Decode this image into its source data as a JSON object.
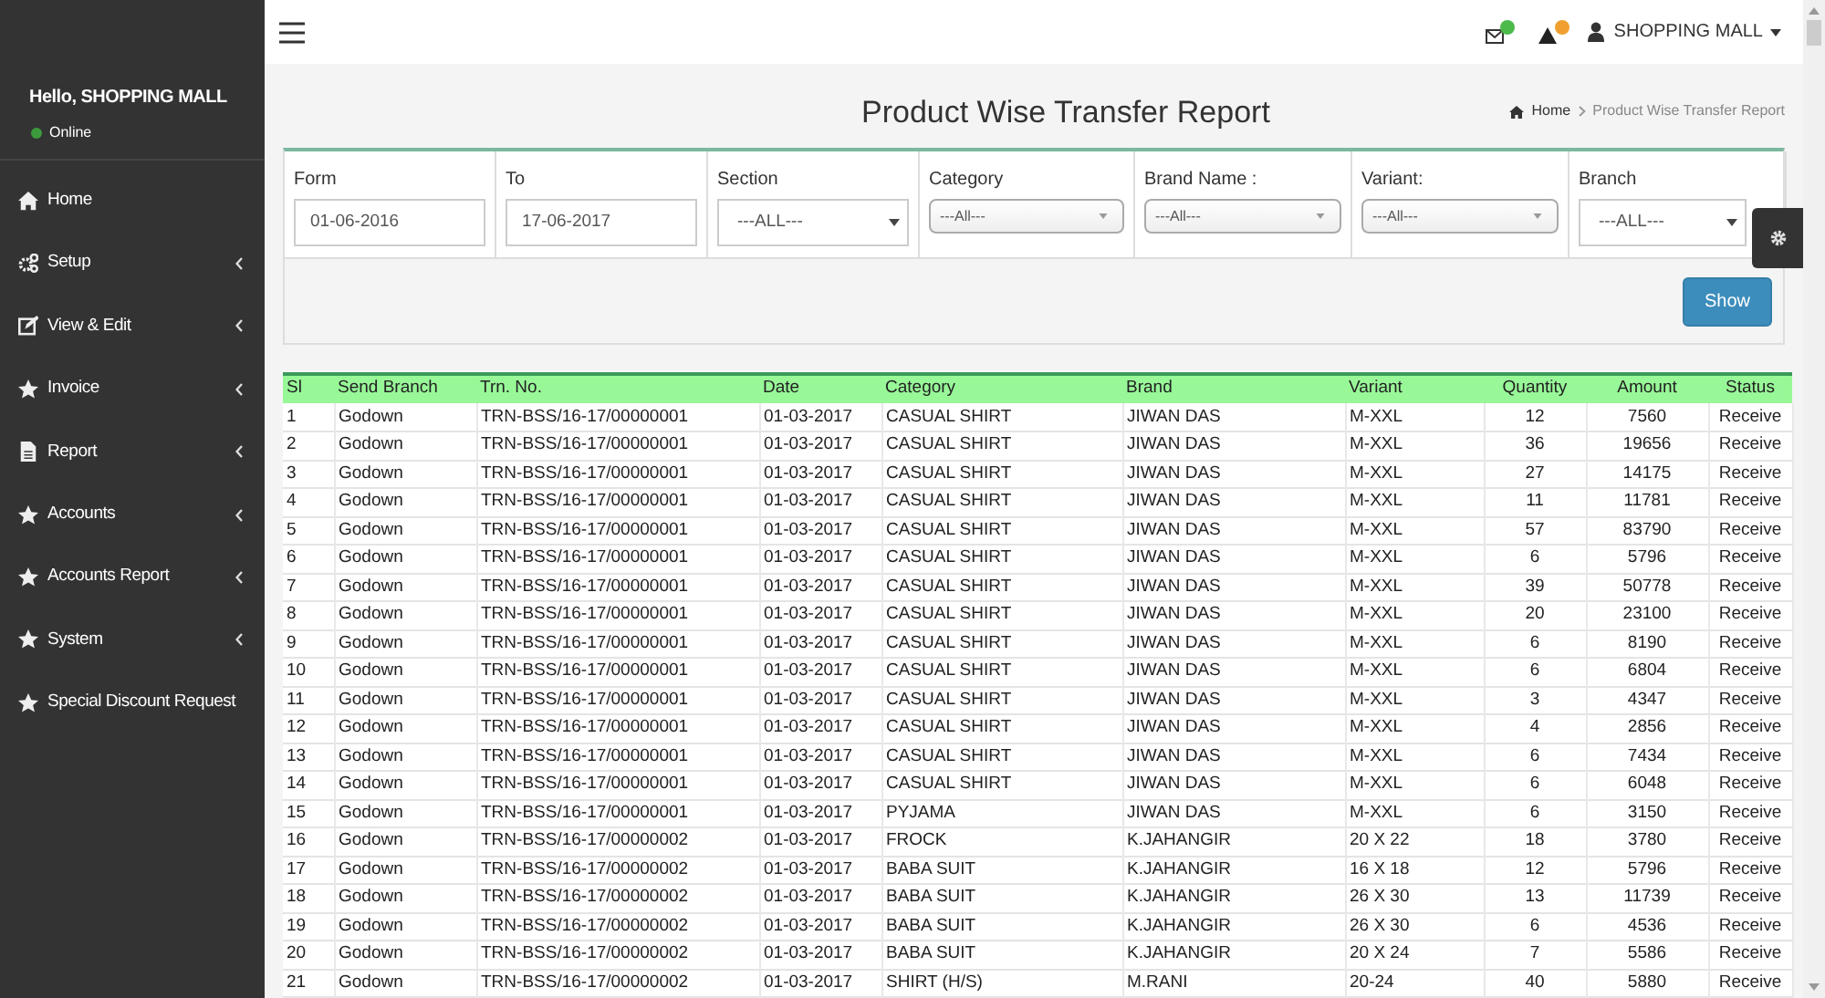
{
  "user_panel": {
    "greeting": "Hello, SHOPPING MALL",
    "status": "Online"
  },
  "sidebar": {
    "items": [
      {
        "label": "Home",
        "submenu": false
      },
      {
        "label": "Setup",
        "submenu": true
      },
      {
        "label": "View & Edit",
        "submenu": true
      },
      {
        "label": "Invoice",
        "submenu": true
      },
      {
        "label": "Report",
        "submenu": true
      },
      {
        "label": "Accounts",
        "submenu": true
      },
      {
        "label": "Accounts Report",
        "submenu": true
      },
      {
        "label": "System",
        "submenu": true
      },
      {
        "label": "Special Discount Request",
        "submenu": false
      }
    ]
  },
  "navbar": {
    "user": "SHOPPING MALL"
  },
  "page_title": "Product Wise Transfer Report",
  "breadcrumb": [
    "Home",
    "Product Wise Transfer Report"
  ],
  "filters": [
    {
      "label": "Form",
      "kind": "text",
      "value": "01-06-2016"
    },
    {
      "label": "To",
      "kind": "text",
      "value": "17-06-2017"
    },
    {
      "label": "Section",
      "kind": "select",
      "value": "---ALL---"
    },
    {
      "label": "Category",
      "kind": "combo",
      "value": "---All---"
    },
    {
      "label": "Brand Name :",
      "kind": "combo",
      "value": "---All---"
    },
    {
      "label": "Variant:",
      "kind": "combo",
      "value": "---All---"
    },
    {
      "label": "Branch",
      "kind": "select",
      "value": "---ALL---"
    }
  ],
  "show_button": "Show",
  "table": {
    "columns": [
      "Sl",
      "Send Branch",
      "Trn. No.",
      "Date",
      "Category",
      "Brand",
      "Variant",
      "Quantity",
      "Amount",
      "Status"
    ],
    "rows": [
      [
        "1",
        "Godown",
        "TRN-BSS/16-17/00000001",
        "01-03-2017",
        "CASUAL SHIRT",
        "JIWAN DAS",
        "M-XXL",
        "12",
        "7560",
        "Receive"
      ],
      [
        "2",
        "Godown",
        "TRN-BSS/16-17/00000001",
        "01-03-2017",
        "CASUAL SHIRT",
        "JIWAN DAS",
        "M-XXL",
        "36",
        "19656",
        "Receive"
      ],
      [
        "3",
        "Godown",
        "TRN-BSS/16-17/00000001",
        "01-03-2017",
        "CASUAL SHIRT",
        "JIWAN DAS",
        "M-XXL",
        "27",
        "14175",
        "Receive"
      ],
      [
        "4",
        "Godown",
        "TRN-BSS/16-17/00000001",
        "01-03-2017",
        "CASUAL SHIRT",
        "JIWAN DAS",
        "M-XXL",
        "11",
        "11781",
        "Receive"
      ],
      [
        "5",
        "Godown",
        "TRN-BSS/16-17/00000001",
        "01-03-2017",
        "CASUAL SHIRT",
        "JIWAN DAS",
        "M-XXL",
        "57",
        "83790",
        "Receive"
      ],
      [
        "6",
        "Godown",
        "TRN-BSS/16-17/00000001",
        "01-03-2017",
        "CASUAL SHIRT",
        "JIWAN DAS",
        "M-XXL",
        "6",
        "5796",
        "Receive"
      ],
      [
        "7",
        "Godown",
        "TRN-BSS/16-17/00000001",
        "01-03-2017",
        "CASUAL SHIRT",
        "JIWAN DAS",
        "M-XXL",
        "39",
        "50778",
        "Receive"
      ],
      [
        "8",
        "Godown",
        "TRN-BSS/16-17/00000001",
        "01-03-2017",
        "CASUAL SHIRT",
        "JIWAN DAS",
        "M-XXL",
        "20",
        "23100",
        "Receive"
      ],
      [
        "9",
        "Godown",
        "TRN-BSS/16-17/00000001",
        "01-03-2017",
        "CASUAL SHIRT",
        "JIWAN DAS",
        "M-XXL",
        "6",
        "8190",
        "Receive"
      ],
      [
        "10",
        "Godown",
        "TRN-BSS/16-17/00000001",
        "01-03-2017",
        "CASUAL SHIRT",
        "JIWAN DAS",
        "M-XXL",
        "6",
        "6804",
        "Receive"
      ],
      [
        "11",
        "Godown",
        "TRN-BSS/16-17/00000001",
        "01-03-2017",
        "CASUAL SHIRT",
        "JIWAN DAS",
        "M-XXL",
        "3",
        "4347",
        "Receive"
      ],
      [
        "12",
        "Godown",
        "TRN-BSS/16-17/00000001",
        "01-03-2017",
        "CASUAL SHIRT",
        "JIWAN DAS",
        "M-XXL",
        "4",
        "2856",
        "Receive"
      ],
      [
        "13",
        "Godown",
        "TRN-BSS/16-17/00000001",
        "01-03-2017",
        "CASUAL SHIRT",
        "JIWAN DAS",
        "M-XXL",
        "6",
        "7434",
        "Receive"
      ],
      [
        "14",
        "Godown",
        "TRN-BSS/16-17/00000001",
        "01-03-2017",
        "CASUAL SHIRT",
        "JIWAN DAS",
        "M-XXL",
        "6",
        "6048",
        "Receive"
      ],
      [
        "15",
        "Godown",
        "TRN-BSS/16-17/00000001",
        "01-03-2017",
        "PYJAMA",
        "JIWAN DAS",
        "M-XXL",
        "6",
        "3150",
        "Receive"
      ],
      [
        "16",
        "Godown",
        "TRN-BSS/16-17/00000002",
        "01-03-2017",
        "FROCK",
        "K.JAHANGIR",
        "20 X 22",
        "18",
        "3780",
        "Receive"
      ],
      [
        "17",
        "Godown",
        "TRN-BSS/16-17/00000002",
        "01-03-2017",
        "BABA SUIT",
        "K.JAHANGIR",
        "16 X 18",
        "12",
        "5796",
        "Receive"
      ],
      [
        "18",
        "Godown",
        "TRN-BSS/16-17/00000002",
        "01-03-2017",
        "BABA SUIT",
        "K.JAHANGIR",
        "26 X 30",
        "13",
        "11739",
        "Receive"
      ],
      [
        "19",
        "Godown",
        "TRN-BSS/16-17/00000002",
        "01-03-2017",
        "BABA SUIT",
        "K.JAHANGIR",
        "26 X 30",
        "6",
        "4536",
        "Receive"
      ],
      [
        "20",
        "Godown",
        "TRN-BSS/16-17/00000002",
        "01-03-2017",
        "BABA SUIT",
        "K.JAHANGIR",
        "20 X 24",
        "7",
        "5586",
        "Receive"
      ],
      [
        "21",
        "Godown",
        "TRN-BSS/16-17/00000002",
        "01-03-2017",
        "SHIRT (H/S)",
        "M.RANI",
        "20-24",
        "40",
        "5880",
        "Receive"
      ]
    ]
  }
}
